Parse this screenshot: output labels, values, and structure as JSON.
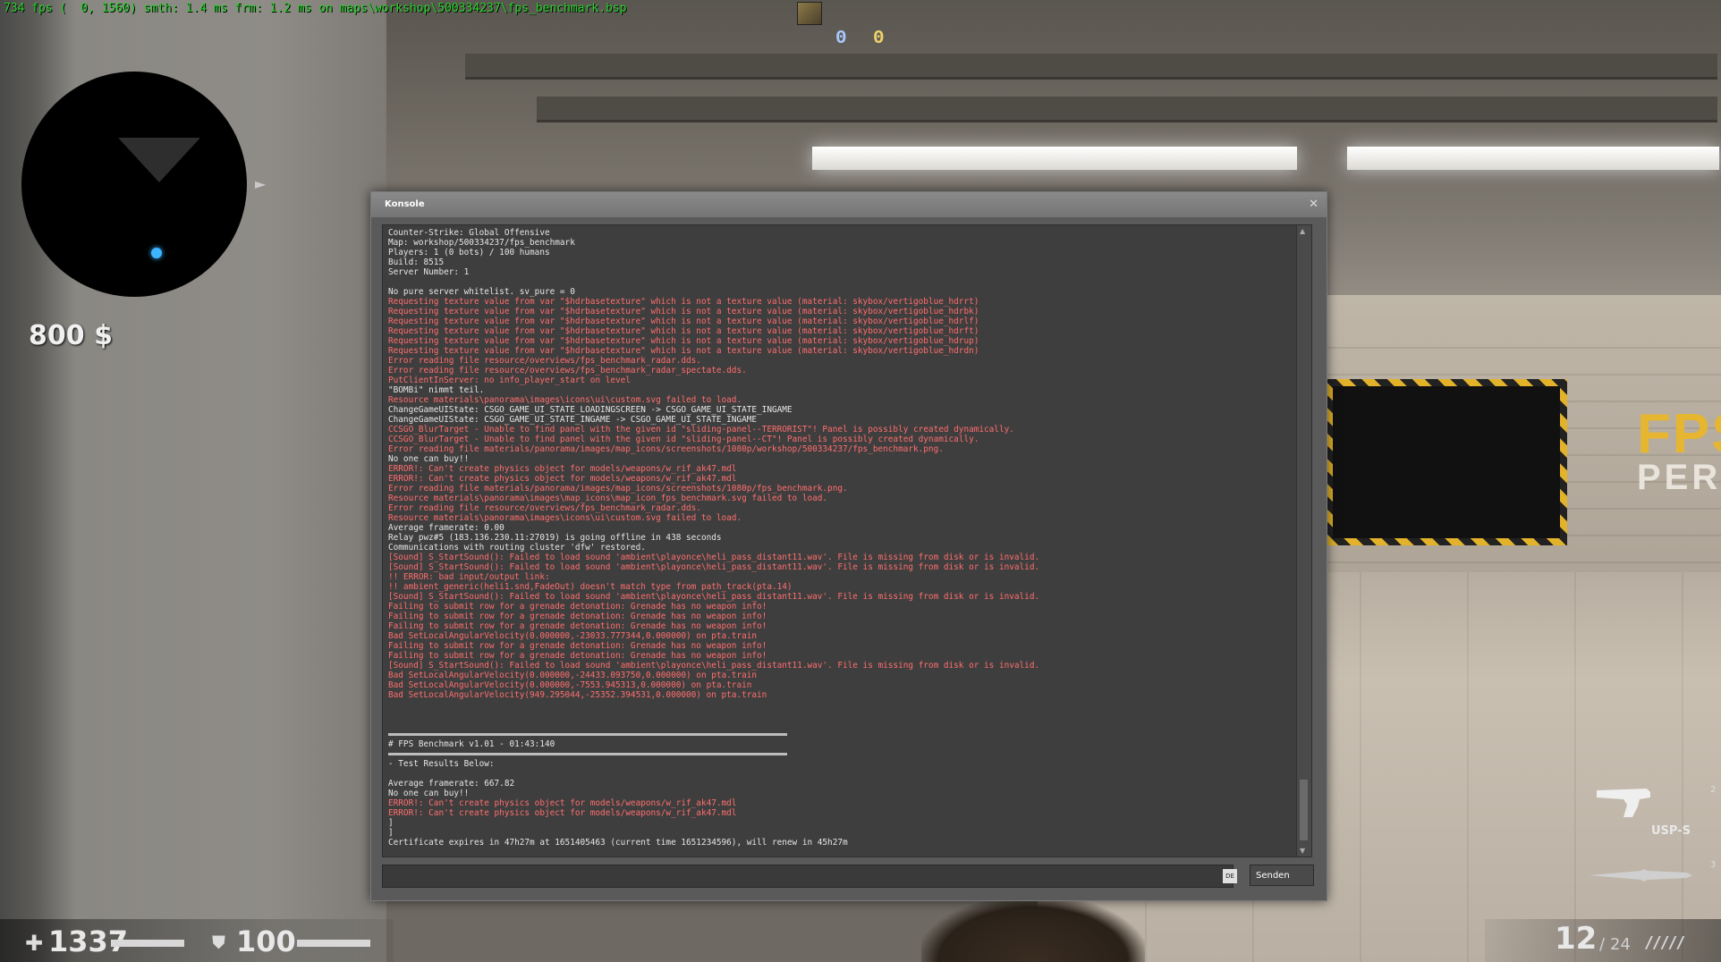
{
  "hud": {
    "fps_line": "734 fps (  0, 1560) smth: 1.4 ms frm: 1.2 ms on maps\\workshop\\500334237\\fps_benchmark.bsp",
    "score_ct": "0",
    "score_t": "0",
    "money": "800 $",
    "health": "1337",
    "armor": "100",
    "health_fraction": 1.0,
    "armor_fraction": 1.0,
    "weapon_name": "USP-S",
    "slot_pistol": "2",
    "slot_knife": "3",
    "ammo_clip": "12",
    "ammo_sep": "/",
    "ammo_reserve": "24",
    "ammo_bullets": "/////"
  },
  "world": {
    "sign_fps": "FPS",
    "sign_perf": "PERF"
  },
  "console": {
    "title": "Konsole",
    "close_glyph": "✕",
    "lang": "DE",
    "send_label": "Senden",
    "input_value": "",
    "lines": [
      {
        "t": "Counter-Strike: Global Offensive",
        "k": "n"
      },
      {
        "t": "Map: workshop/500334237/fps_benchmark",
        "k": "n"
      },
      {
        "t": "Players: 1 (0 bots) / 100 humans",
        "k": "n"
      },
      {
        "t": "Build: 8515",
        "k": "n"
      },
      {
        "t": "Server Number: 1",
        "k": "n"
      },
      {
        "t": "",
        "k": "n"
      },
      {
        "t": "No pure server whitelist. sv_pure = 0",
        "k": "n"
      },
      {
        "t": "Requesting texture value from var \"$hdrbasetexture\" which is not a texture value (material: skybox/vertigoblue_hdrrt)",
        "k": "e"
      },
      {
        "t": "Requesting texture value from var \"$hdrbasetexture\" which is not a texture value (material: skybox/vertigoblue_hdrbk)",
        "k": "e"
      },
      {
        "t": "Requesting texture value from var \"$hdrbasetexture\" which is not a texture value (material: skybox/vertigoblue_hdrlf)",
        "k": "e"
      },
      {
        "t": "Requesting texture value from var \"$hdrbasetexture\" which is not a texture value (material: skybox/vertigoblue_hdrft)",
        "k": "e"
      },
      {
        "t": "Requesting texture value from var \"$hdrbasetexture\" which is not a texture value (material: skybox/vertigoblue_hdrup)",
        "k": "e"
      },
      {
        "t": "Requesting texture value from var \"$hdrbasetexture\" which is not a texture value (material: skybox/vertigoblue_hdrdn)",
        "k": "e"
      },
      {
        "t": "Error reading file resource/overviews/fps_benchmark_radar.dds.",
        "k": "e"
      },
      {
        "t": "Error reading file resource/overviews/fps_benchmark_radar_spectate.dds.",
        "k": "e"
      },
      {
        "t": "PutClientInServer: no info_player_start on level",
        "k": "e"
      },
      {
        "t": "\"BOMBi\" nimmt teil.",
        "k": "n"
      },
      {
        "t": "Resource materials\\panorama\\images\\icons\\ui\\custom.svg failed to load.",
        "k": "e"
      },
      {
        "t": "ChangeGameUIState: CSGO_GAME_UI_STATE_LOADINGSCREEN -> CSGO_GAME_UI_STATE_INGAME",
        "k": "n"
      },
      {
        "t": "ChangeGameUIState: CSGO_GAME_UI_STATE_INGAME -> CSGO_GAME_UI_STATE_INGAME",
        "k": "n"
      },
      {
        "t": "CCSGO_BlurTarget - Unable to find panel with the given id \"sliding-panel--TERRORIST\"! Panel is possibly created dynamically.",
        "k": "e"
      },
      {
        "t": "CCSGO_BlurTarget - Unable to find panel with the given id \"sliding-panel--CT\"! Panel is possibly created dynamically.",
        "k": "e"
      },
      {
        "t": "Error reading file materials/panorama/images/map_icons/screenshots/1080p/workshop/500334237/fps_benchmark.png.",
        "k": "e"
      },
      {
        "t": "No one can buy!!",
        "k": "n"
      },
      {
        "t": "ERROR!: Can't create physics object for models/weapons/w_rif_ak47.mdl",
        "k": "e"
      },
      {
        "t": "ERROR!: Can't create physics object for models/weapons/w_rif_ak47.mdl",
        "k": "e"
      },
      {
        "t": "Error reading file materials/panorama/images/map_icons/screenshots/1080p/fps_benchmark.png.",
        "k": "e"
      },
      {
        "t": "Resource materials\\panorama\\images\\map_icons\\map_icon_fps_benchmark.svg failed to load.",
        "k": "e"
      },
      {
        "t": "Error reading file resource/overviews/fps_benchmark_radar.dds.",
        "k": "e"
      },
      {
        "t": "Resource materials\\panorama\\images\\icons\\ui\\custom.svg failed to load.",
        "k": "e"
      },
      {
        "t": "Average framerate: 0.00",
        "k": "n"
      },
      {
        "t": "Relay pwz#5 (183.136.230.11:27019) is going offline in 438 seconds",
        "k": "n"
      },
      {
        "t": "Communications with routing cluster 'dfw' restored.",
        "k": "n"
      },
      {
        "t": "[Sound] S_StartSound(): Failed to load sound 'ambient\\playonce\\heli_pass_distant11.wav'. File is missing from disk or is invalid.",
        "k": "e"
      },
      {
        "t": "[Sound] S_StartSound(): Failed to load sound 'ambient\\playonce\\heli_pass_distant11.wav'. File is missing from disk or is invalid.",
        "k": "e"
      },
      {
        "t": "!! ERROR: bad input/output link:",
        "k": "e"
      },
      {
        "t": "!! ambient_generic(heli1.snd,FadeOut) doesn't match type from path_track(pta.14)",
        "k": "e"
      },
      {
        "t": "[Sound] S_StartSound(): Failed to load sound 'ambient\\playonce\\heli_pass_distant11.wav'. File is missing from disk or is invalid.",
        "k": "e"
      },
      {
        "t": "Failing to submit row for a grenade detonation: Grenade has no weapon info!",
        "k": "e"
      },
      {
        "t": "Failing to submit row for a grenade detonation: Grenade has no weapon info!",
        "k": "e"
      },
      {
        "t": "Failing to submit row for a grenade detonation: Grenade has no weapon info!",
        "k": "e"
      },
      {
        "t": "Bad SetLocalAngularVelocity(0.000000,-23033.777344,0.000000) on pta.train",
        "k": "e"
      },
      {
        "t": "Failing to submit row for a grenade detonation: Grenade has no weapon info!",
        "k": "e"
      },
      {
        "t": "Failing to submit row for a grenade detonation: Grenade has no weapon info!",
        "k": "e"
      },
      {
        "t": "[Sound] S_StartSound(): Failed to load sound 'ambient\\playonce\\heli_pass_distant11.wav'. File is missing from disk or is invalid.",
        "k": "e"
      },
      {
        "t": "Bad SetLocalAngularVelocity(0.000000,-24433.093750,0.000000) on pta.train",
        "k": "e"
      },
      {
        "t": "Bad SetLocalAngularVelocity(0.000000,-7553.945313,0.000000) on pta.train",
        "k": "e"
      },
      {
        "t": "Bad SetLocalAngularVelocity(949.295044,-25352.394531,0.000000) on pta.train",
        "k": "e"
      },
      {
        "t": "",
        "k": "n"
      },
      {
        "t": "",
        "k": "n"
      },
      {
        "t": "",
        "k": "n"
      },
      {
        "t": "",
        "k": "s"
      },
      {
        "t": "# FPS Benchmark v1.01 - 01:43:140",
        "k": "n"
      },
      {
        "t": "",
        "k": "s"
      },
      {
        "t": "- Test Results Below:",
        "k": "n"
      },
      {
        "t": "",
        "k": "n"
      },
      {
        "t": "Average framerate: 667.82",
        "k": "n"
      },
      {
        "t": "No one can buy!!",
        "k": "n"
      },
      {
        "t": "ERROR!: Can't create physics object for models/weapons/w_rif_ak47.mdl",
        "k": "e"
      },
      {
        "t": "ERROR!: Can't create physics object for models/weapons/w_rif_ak47.mdl",
        "k": "e"
      },
      {
        "t": "]",
        "k": "n"
      },
      {
        "t": "]",
        "k": "n"
      },
      {
        "t": "Certificate expires in 47h27m at 1651405463 (current time 1651234596), will renew in 45h27m",
        "k": "n"
      }
    ]
  }
}
